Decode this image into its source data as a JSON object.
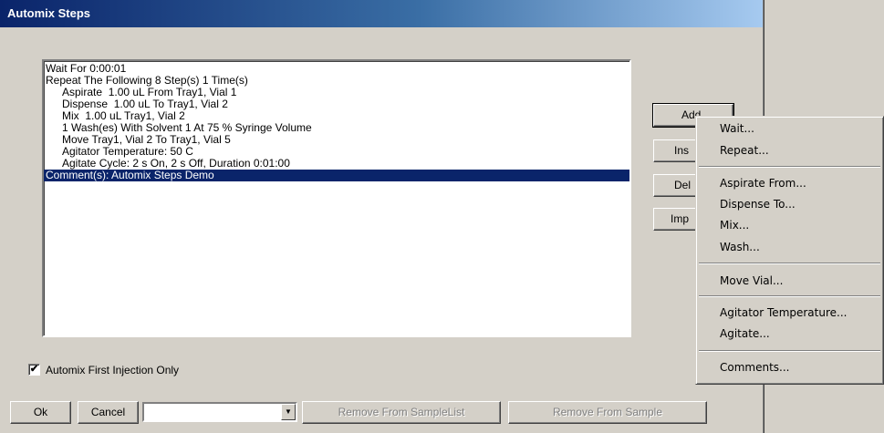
{
  "title": "Automix Steps",
  "steps": [
    {
      "text": "Wait For 0:00:01",
      "indent": false
    },
    {
      "text": "Repeat The Following 8 Step(s) 1 Time(s)",
      "indent": false
    },
    {
      "text": "Aspirate  1.00 uL From Tray1, Vial 1",
      "indent": true
    },
    {
      "text": "Dispense  1.00 uL To Tray1, Vial 2",
      "indent": true
    },
    {
      "text": "Mix  1.00 uL Tray1, Vial 2",
      "indent": true
    },
    {
      "text": "1 Wash(es) With Solvent 1 At 75 % Syringe Volume",
      "indent": true
    },
    {
      "text": "Move Tray1, Vial 2 To Tray1, Vial 5",
      "indent": true
    },
    {
      "text": "Agitator Temperature: 50 C",
      "indent": true
    },
    {
      "text": "Agitate Cycle: 2 s On, 2 s Off, Duration 0:01:00",
      "indent": true
    },
    {
      "text": "Comment(s): Automix Steps Demo",
      "indent": false,
      "selected": true
    }
  ],
  "side_buttons": {
    "add": "Add",
    "insert": "Ins",
    "delete": "Del",
    "import": "Imp"
  },
  "checkbox": {
    "label": "Automix First Injection Only",
    "checked": true
  },
  "bottom": {
    "ok": "Ok",
    "cancel": "Cancel",
    "combo_value": "",
    "remove_from_samplelist": "Remove From SampleList",
    "remove_from_sample": "Remove From Sample"
  },
  "context_menu": {
    "items": [
      "Wait...",
      "Repeat...",
      "Aspirate From...",
      "Dispense To...",
      "Mix...",
      "Wash...",
      "Move Vial...",
      "Agitator Temperature...",
      "Agitate...",
      "Comments..."
    ]
  },
  "colors": {
    "selection": "#0a246a",
    "face": "#d4d0c8",
    "title_gradient_start": "#0a246a",
    "title_gradient_end": "#a6caf0"
  }
}
